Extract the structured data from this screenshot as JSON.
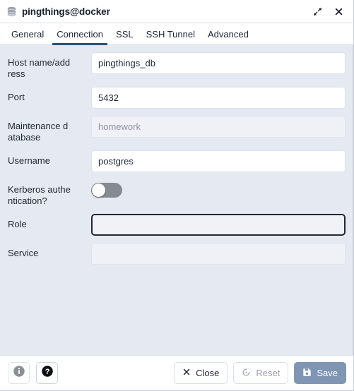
{
  "window": {
    "title": "pingthings@docker",
    "icon": "database-stack-icon",
    "expand_icon": "expand-diagonal-icon",
    "close_icon": "close-x-icon"
  },
  "tabs": [
    {
      "label": "General",
      "active": false
    },
    {
      "label": "Connection",
      "active": true
    },
    {
      "label": "SSL",
      "active": false
    },
    {
      "label": "SSH Tunnel",
      "active": false
    },
    {
      "label": "Advanced",
      "active": false
    }
  ],
  "form": {
    "fields": [
      {
        "label": "Host name/address",
        "value": "pingthings_db",
        "placeholder": "",
        "state": "normal"
      },
      {
        "label": "Port",
        "value": "5432",
        "placeholder": "",
        "state": "normal"
      },
      {
        "label": "Maintenance database",
        "value": "",
        "placeholder": "homework",
        "state": "disabled"
      },
      {
        "label": "Username",
        "value": "postgres",
        "placeholder": "",
        "state": "normal"
      },
      {
        "label": "Kerberos authentication?",
        "value": "off",
        "type": "toggle"
      },
      {
        "label": "Role",
        "value": "",
        "placeholder": "",
        "state": "focused"
      },
      {
        "label": "Service",
        "value": "",
        "placeholder": "",
        "state": "disabled"
      }
    ]
  },
  "footer": {
    "info_icon": "info-circle-icon",
    "help_icon": "help-circle-icon",
    "close_label": "Close",
    "close_icon": "close-x-icon",
    "reset_label": "Reset",
    "reset_icon": "reset-circular-arrow-icon",
    "save_label": "Save",
    "save_icon": "floppy-disk-icon"
  },
  "colors": {
    "panel_background": "#e5e9f1",
    "tab_active_underline": "#2f5074",
    "save_button": "#7f95b3",
    "toggle_off_track": "#868b93",
    "focus_border": "#23282f"
  }
}
